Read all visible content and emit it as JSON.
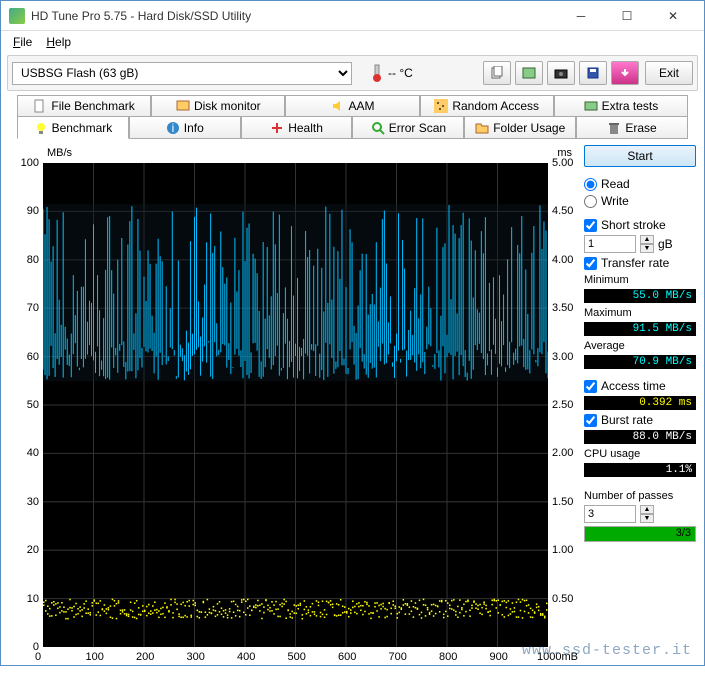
{
  "window": {
    "title": "HD Tune Pro 5.75 - Hard Disk/SSD Utility"
  },
  "menu": {
    "file": "File",
    "help": "Help"
  },
  "toolbar": {
    "drive": "USBSG Flash (63 gB)",
    "temp": "-- °C",
    "exit": "Exit"
  },
  "tabs_top": [
    {
      "label": "File Benchmark"
    },
    {
      "label": "Disk monitor"
    },
    {
      "label": "AAM"
    },
    {
      "label": "Random Access"
    },
    {
      "label": "Extra tests"
    }
  ],
  "tabs_bottom": [
    {
      "label": "Benchmark",
      "active": true
    },
    {
      "label": "Info"
    },
    {
      "label": "Health"
    },
    {
      "label": "Error Scan"
    },
    {
      "label": "Folder Usage"
    },
    {
      "label": "Erase"
    }
  ],
  "chart": {
    "ylabel": "MB/s",
    "y2label": "ms",
    "xlabel_right": "1000mB",
    "y_ticks": [
      0,
      10,
      20,
      30,
      40,
      50,
      60,
      70,
      80,
      90,
      100
    ],
    "y2_ticks": [
      "0.50",
      "1.00",
      "1.50",
      "2.00",
      "2.50",
      "3.00",
      "3.50",
      "4.00",
      "4.50",
      "5.00"
    ],
    "x_ticks": [
      0,
      100,
      200,
      300,
      400,
      500,
      600,
      700,
      800,
      900
    ]
  },
  "chart_data": {
    "type": "line",
    "x_range": [
      0,
      1000
    ],
    "y_range": [
      0,
      100
    ],
    "y2_range": [
      0,
      5.0
    ],
    "series": [
      {
        "name": "Transfer rate",
        "color": "#00bfff",
        "unit": "MB/s",
        "min": 55.0,
        "max": 91.5,
        "mean": 70.9,
        "description": "dense oscillation between ~55 and ~91 MB/s across full range"
      },
      {
        "name": "Access time",
        "color": "#ffff00",
        "unit": "ms",
        "band_low": 0.3,
        "band_high": 0.5,
        "mean": 0.392,
        "description": "scattered points mostly between 0.3 and 0.5 ms"
      }
    ]
  },
  "side": {
    "start": "Start",
    "read": "Read",
    "write": "Write",
    "short_stroke": "Short stroke",
    "short_val": "1",
    "short_unit": "gB",
    "transfer": "Transfer rate",
    "min_lbl": "Minimum",
    "min_val": "55.0 MB/s",
    "max_lbl": "Maximum",
    "max_val": "91.5 MB/s",
    "avg_lbl": "Average",
    "avg_val": "70.9 MB/s",
    "acc_lbl": "Access time",
    "acc_val": "0.392 ms",
    "burst_lbl": "Burst rate",
    "burst_val": "88.0 MB/s",
    "cpu_lbl": "CPU usage",
    "cpu_val": "1.1%",
    "passes_lbl": "Number of passes",
    "passes_val": "3",
    "passes_prog": "3/3"
  },
  "watermark": "www.ssd-tester.it"
}
